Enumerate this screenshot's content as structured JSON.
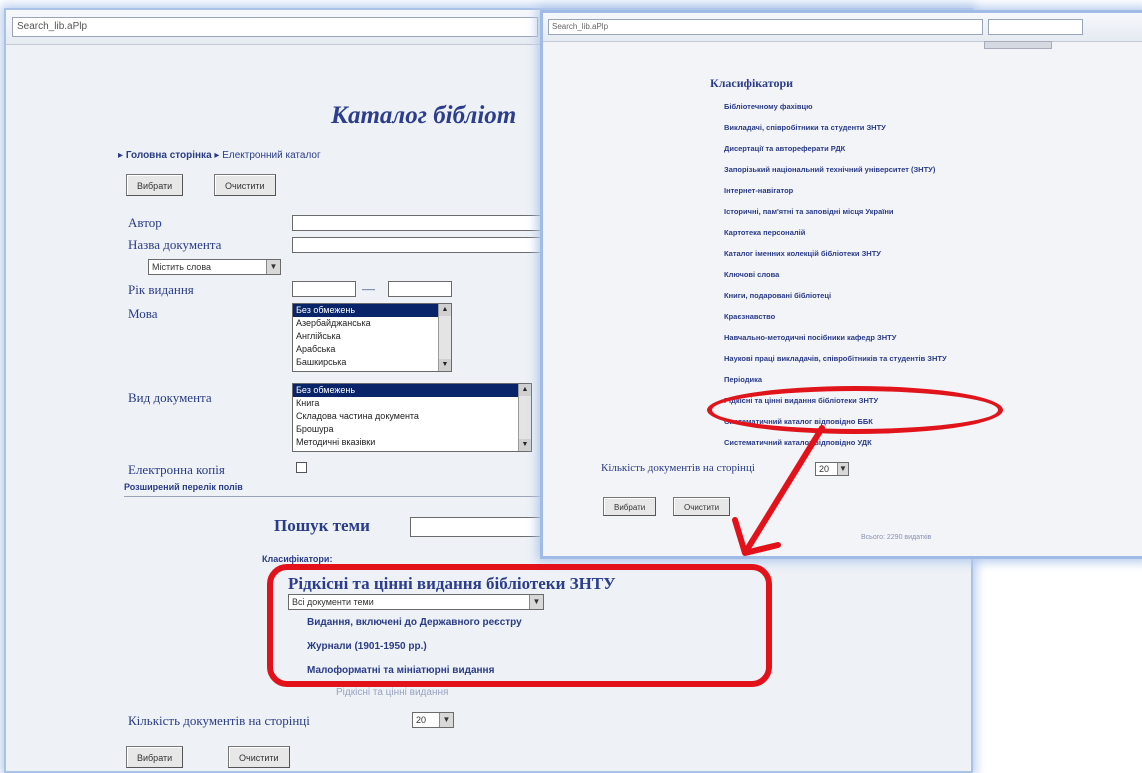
{
  "back_window": {
    "address": "Search_lib.aPlp",
    "title": "Каталог бібліот",
    "breadcrumb": {
      "home": "Головна сторінка",
      "separator": "▸",
      "current": "Електронний каталог"
    },
    "buttons": {
      "select": "Вибрати",
      "clear": "Очистити"
    },
    "labels": {
      "author": "Автор",
      "doc_name": "Назва документа",
      "year": "Рік видання",
      "year_dash": "—",
      "language": "Мова",
      "doc_type": "Вид документа",
      "e_copy": "Електронна копія",
      "advanced": "Розширений перелік полів",
      "subject": "Пошук теми",
      "classifiers": "Класифікатори:"
    },
    "name_mode": "Містить слова",
    "languages": [
      "Без обмежень",
      "Азербайджанська",
      "Англійська",
      "Арабська",
      "Башкирська"
    ],
    "doc_types": [
      "Без обмежень",
      "Книга",
      "Складова частина документа",
      "Брошура",
      "Методичні вказівки"
    ],
    "selected_classifier": "Рідкісні та цінні видання бібліотеки ЗНТУ",
    "subject_filter": "Всі документи теми",
    "sub_links": [
      "Видання, включені до Державного реєстру",
      "Журнали (1901-1950 рр.)",
      "Малоформатні та мініатюрні видання"
    ],
    "faded_link": "Рідкісні та цінні видання",
    "per_page_label": "Кількість документів на сторінці",
    "per_page": "20"
  },
  "front_window": {
    "address": "Search_lib.aPlp",
    "heading": "Класифікатори",
    "links": [
      "Бібліотечному фахівцю",
      "Викладачі, співробітники та студенти ЗНТУ",
      "Дисертації та автореферати РДК",
      "Запорізький національний технічний університет (ЗНТУ)",
      "Інтернет-навігатор",
      "Історичні, пам'ятні та заповідні місця України",
      "Картотека персоналій",
      "Каталог іменних колекцій бібліотеки ЗНТУ",
      "Ключові слова",
      "Книги, подаровані бібліотеці",
      "Краєзнавство",
      "Навчально-методичні посібники кафедр ЗНТУ",
      "Наукові праці викладачів, співробітників та студентів ЗНТУ",
      "Періодика",
      "Рідкісні та цінні видання бібліотеки ЗНТУ",
      "Систематичний каталог відповідно ББК",
      "Систематичний каталог відповідно УДК"
    ],
    "per_page_label": "Кількість документів на сторінці",
    "per_page": "20",
    "buttons": {
      "select": "Вибрати",
      "clear": "Очистити"
    },
    "footer": "Всього: 2290 видатків"
  },
  "annotation_color": "#e3121a"
}
